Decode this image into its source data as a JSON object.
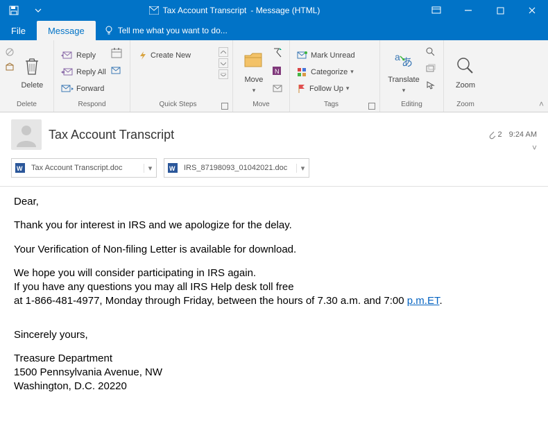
{
  "window": {
    "title_doc": "Tax Account Transcript",
    "title_type": "- Message (HTML)"
  },
  "tabs": {
    "file": "File",
    "message": "Message",
    "tellme": "Tell me what you want to do..."
  },
  "ribbon": {
    "delete": {
      "big_label": "Delete",
      "group_label": "Delete"
    },
    "respond": {
      "reply": "Reply",
      "reply_all": "Reply All",
      "forward": "Forward",
      "group_label": "Respond"
    },
    "quicksteps": {
      "create_new": "Create New",
      "group_label": "Quick Steps"
    },
    "move": {
      "move": "Move",
      "group_label": "Move"
    },
    "tags": {
      "mark_unread": "Mark Unread",
      "categorize": "Categorize",
      "follow_up": "Follow Up",
      "group_label": "Tags"
    },
    "editing": {
      "translate": "Translate",
      "group_label": "Editing"
    },
    "zoom": {
      "zoom": "Zoom",
      "group_label": "Zoom"
    }
  },
  "header": {
    "attachment_count": "2",
    "time": "9:24 AM",
    "subject": "Tax Account Transcript"
  },
  "attachments": [
    {
      "name": "Tax Account Transcript.doc"
    },
    {
      "name": "IRS_87198093_01042021.doc"
    }
  ],
  "body": {
    "greeting": "Dear,",
    "p1": "Thank you for interest in IRS and we apologize for the delay.",
    "p2": "Your Verification of Non-filing Letter is available for download.",
    "p3a": "We hope you will consider participating in IRS again.",
    "p3b": "If you have any questions you may all IRS Help desk toll free",
    "p3c_prefix": "at 1-866-481-4977, Monday through Friday, between the hours of 7.30 a.m. and 7:00 ",
    "p3c_link": "p.m.ET",
    "p3c_suffix": ".",
    "signoff": "Sincerely yours,",
    "sig1": "Treasure Department",
    "sig2": "1500 Pennsylvania Avenue, NW",
    "sig3": "Washington, D.C. 20220"
  }
}
